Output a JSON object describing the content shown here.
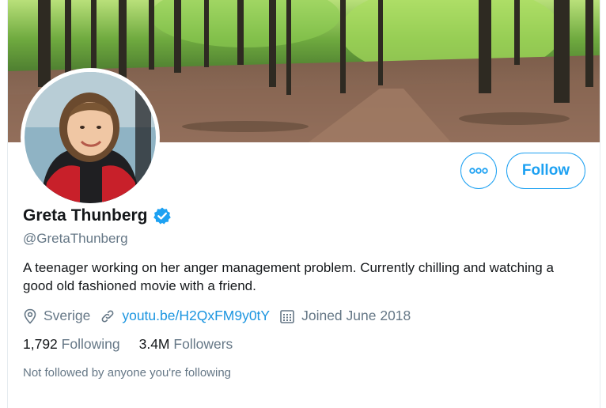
{
  "profile": {
    "display_name": "Greta Thunberg",
    "handle": "@GretaThunberg",
    "bio": "A teenager working on her anger management problem. Currently chilling and watching a good old fashioned movie with a friend.",
    "location": "Sverige",
    "website": "youtu.be/H2QxFM9y0tY",
    "joined": "Joined June 2018",
    "verified_icon": "verified-badge-icon"
  },
  "actions": {
    "more_icon": "more-dots-icon",
    "follow_label": "Follow"
  },
  "stats": {
    "following_count": "1,792",
    "following_label": "Following",
    "followers_count": "3.4M",
    "followers_label": "Followers"
  },
  "footer": {
    "not_followed": "Not followed by anyone you're following"
  },
  "colors": {
    "accent": "#1da1f2",
    "link": "#1b95e0",
    "text": "#14171a",
    "muted": "#657786"
  }
}
